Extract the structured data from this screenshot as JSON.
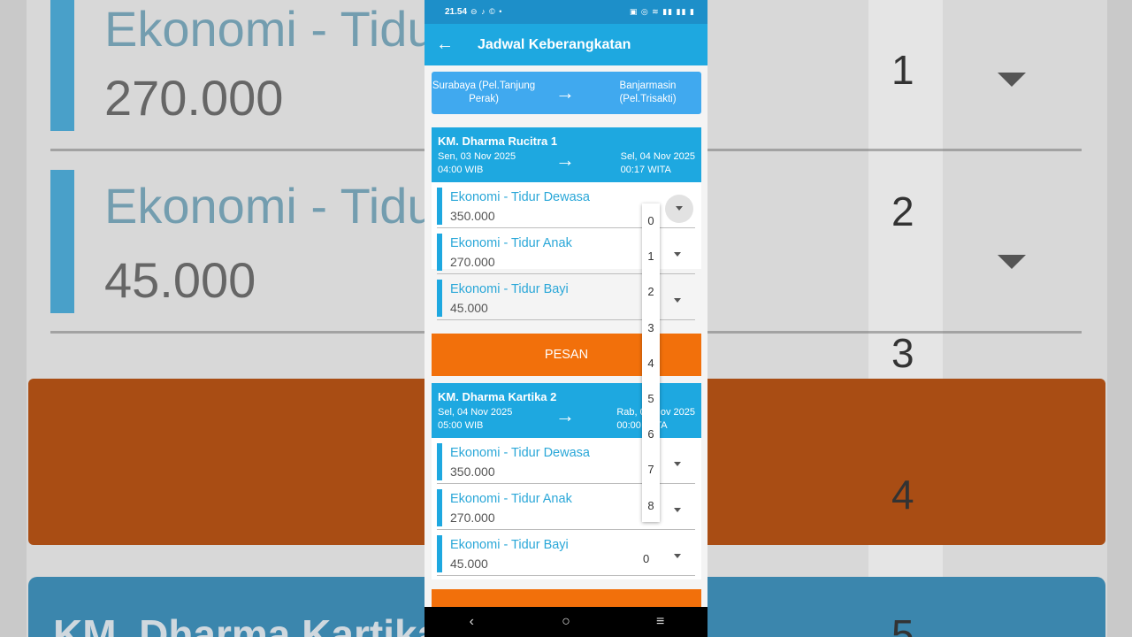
{
  "background": {
    "items": [
      {
        "name": "Ekonomi - Tidur Anak",
        "price": "270.000"
      },
      {
        "name": "Ekonomi - Tidur Bayi",
        "price": "45.000"
      }
    ],
    "numbers": [
      "1",
      "2",
      "3",
      "4",
      "5"
    ],
    "next_card_title": "KM. Dharma Kartika 2"
  },
  "statusbar": {
    "time": "21.54",
    "left_icons": "⊖ ♪ © •",
    "right_icons": "▣ ◎ ≋ ▮▮ ▮▮ ▮"
  },
  "appbar": {
    "back_icon": "←",
    "title": "Jadwal Keberangkatan"
  },
  "route": {
    "from": "Surabaya (Pel.Tanjung Perak)",
    "arrow": "→",
    "to": "Banjarmasin (Pel.Trisakti)"
  },
  "cards": [
    {
      "ship": "KM. Dharma Rucitra 1",
      "dep_date": "Sen, 03 Nov 2025",
      "dep_time": "04:00 WIB",
      "arr_date": "Sel, 04 Nov 2025",
      "arr_time": "00:17 WITA",
      "tickets": [
        {
          "name": "Ekonomi - Tidur Dewasa",
          "price": "350.000",
          "qty": "0"
        },
        {
          "name": "Ekonomi - Tidur Anak",
          "price": "270.000",
          "qty": "0"
        },
        {
          "name": "Ekonomi - Tidur Bayi",
          "price": "45.000",
          "qty": "0"
        }
      ],
      "button": "PESAN"
    },
    {
      "ship": "KM. Dharma Kartika 2",
      "dep_date": "Sel, 04 Nov 2025",
      "dep_time": "05:00 WIB",
      "arr_date": "Rab, 05 Nov 2025",
      "arr_time": "00:00 WITA",
      "tickets": [
        {
          "name": "Ekonomi - Tidur Dewasa",
          "price": "350.000",
          "qty": "0"
        },
        {
          "name": "Ekonomi - Tidur Anak",
          "price": "270.000",
          "qty": "0"
        },
        {
          "name": "Ekonomi - Tidur Bayi",
          "price": "45.000",
          "qty": "0"
        }
      ]
    }
  ],
  "dropdown_options": [
    "0",
    "1",
    "2",
    "3",
    "4",
    "5",
    "6",
    "7",
    "8"
  ],
  "navbar": {
    "back": "‹",
    "home": "○",
    "menu": "≡"
  },
  "colors": {
    "primary": "#1ea8e0",
    "route_bg": "#40a9ef",
    "accent": "#f2700b"
  }
}
